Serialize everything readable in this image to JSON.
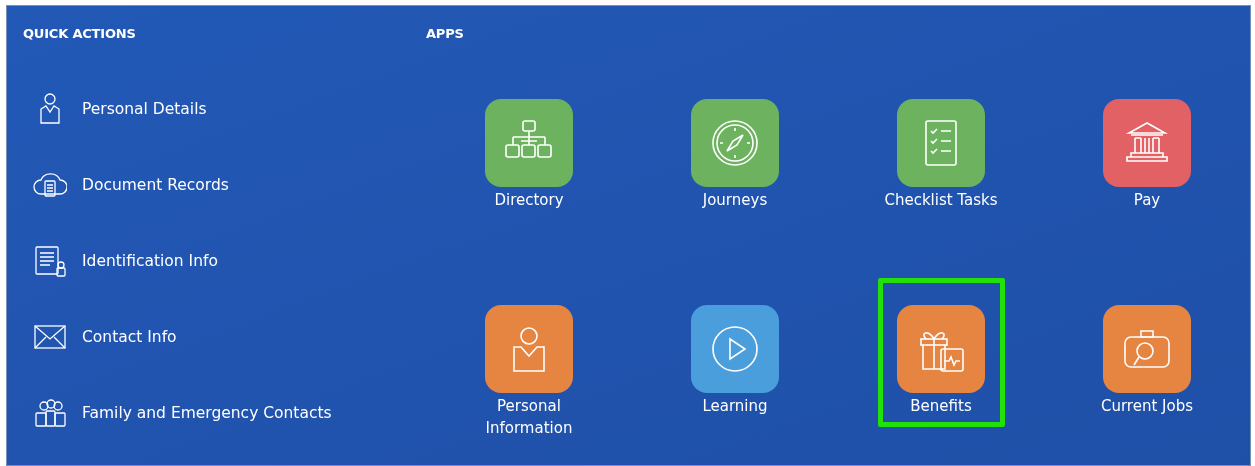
{
  "quick_actions": {
    "title": "QUICK ACTIONS",
    "items": [
      {
        "label": "Personal Details"
      },
      {
        "label": "Document Records"
      },
      {
        "label": "Identification Info"
      },
      {
        "label": "Contact Info"
      },
      {
        "label": "Family and Emergency Contacts"
      }
    ]
  },
  "apps": {
    "title": "APPS",
    "items": [
      {
        "label": "Directory",
        "color": "#6db35f",
        "highlighted": false
      },
      {
        "label": "Journeys",
        "color": "#6db35f",
        "highlighted": false
      },
      {
        "label": "Checklist Tasks",
        "color": "#6db35f",
        "highlighted": false
      },
      {
        "label": "Pay",
        "color": "#e26164",
        "highlighted": false
      },
      {
        "label": "Personal Information",
        "color": "#e68442",
        "highlighted": false
      },
      {
        "label": "Learning",
        "color": "#4a9edc",
        "highlighted": false
      },
      {
        "label": "Benefits",
        "color": "#e68442",
        "highlighted": true
      },
      {
        "label": "Current Jobs",
        "color": "#e68442",
        "highlighted": false
      }
    ]
  }
}
